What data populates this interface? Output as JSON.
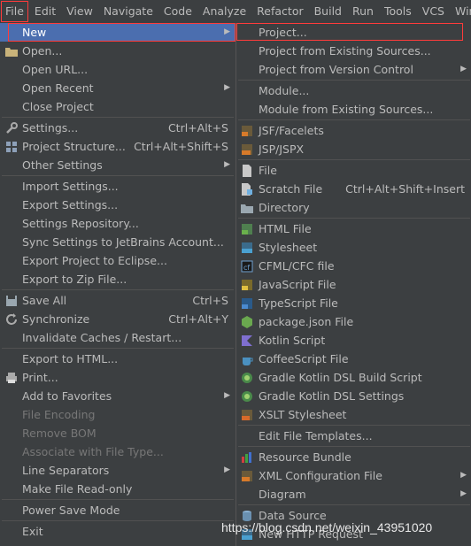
{
  "menubar": [
    "File",
    "Edit",
    "View",
    "Navigate",
    "Code",
    "Analyze",
    "Refactor",
    "Build",
    "Run",
    "Tools",
    "VCS",
    "Windo"
  ],
  "file_menu": [
    {
      "label": "New",
      "arrow": true,
      "selected": true
    },
    {
      "label": "Open...",
      "icon": "folder-icon"
    },
    {
      "label": "Open URL..."
    },
    {
      "label": "Open Recent",
      "arrow": true
    },
    {
      "label": "Close Project"
    },
    {
      "label": "Settings...",
      "icon": "wrench-icon",
      "shortcut": "Ctrl+Alt+S"
    },
    {
      "label": "Project Structure...",
      "icon": "project-structure-icon",
      "shortcut": "Ctrl+Alt+Shift+S"
    },
    {
      "label": "Other Settings",
      "arrow": true
    },
    {
      "label": "Import Settings..."
    },
    {
      "label": "Export Settings..."
    },
    {
      "label": "Settings Repository..."
    },
    {
      "label": "Sync Settings to JetBrains Account..."
    },
    {
      "label": "Export Project to Eclipse..."
    },
    {
      "label": "Export to Zip File..."
    },
    {
      "label": "Save All",
      "icon": "save-icon",
      "shortcut": "Ctrl+S"
    },
    {
      "label": "Synchronize",
      "icon": "sync-icon",
      "shortcut": "Ctrl+Alt+Y"
    },
    {
      "label": "Invalidate Caches / Restart..."
    },
    {
      "label": "Export to HTML..."
    },
    {
      "label": "Print...",
      "icon": "print-icon"
    },
    {
      "label": "Add to Favorites",
      "arrow": true
    },
    {
      "label": "File Encoding",
      "disabled": true
    },
    {
      "label": "Remove BOM",
      "disabled": true
    },
    {
      "label": "Associate with File Type...",
      "disabled": true
    },
    {
      "label": "Line Separators",
      "arrow": true
    },
    {
      "label": "Make File Read-only"
    },
    {
      "label": "Power Save Mode"
    },
    {
      "label": "Exit"
    }
  ],
  "new_menu": [
    {
      "label": "Project..."
    },
    {
      "label": "Project from Existing Sources..."
    },
    {
      "label": "Project from Version Control",
      "arrow": true
    },
    {
      "label": "Module..."
    },
    {
      "label": "Module from Existing Sources..."
    },
    {
      "label": "JSF/Facelets",
      "icon": "jsf-icon"
    },
    {
      "label": "JSP/JSPX",
      "icon": "jsp-icon"
    },
    {
      "label": "File",
      "icon": "file-icon"
    },
    {
      "label": "Scratch File",
      "icon": "scratch-icon",
      "shortcut": "Ctrl+Alt+Shift+Insert"
    },
    {
      "label": "Directory",
      "icon": "directory-icon"
    },
    {
      "label": "HTML File",
      "icon": "html-icon"
    },
    {
      "label": "Stylesheet",
      "icon": "css-icon"
    },
    {
      "label": "CFML/CFC file",
      "icon": "cfml-icon"
    },
    {
      "label": "JavaScript File",
      "icon": "js-icon"
    },
    {
      "label": "TypeScript File",
      "icon": "ts-icon"
    },
    {
      "label": "package.json File",
      "icon": "nodejs-icon"
    },
    {
      "label": "Kotlin Script",
      "icon": "kotlin-icon"
    },
    {
      "label": "CoffeeScript File",
      "icon": "coffee-icon"
    },
    {
      "label": "Gradle Kotlin DSL Build Script",
      "icon": "gradle-icon"
    },
    {
      "label": "Gradle Kotlin DSL Settings",
      "icon": "gradle-icon"
    },
    {
      "label": "XSLT Stylesheet",
      "icon": "xslt-icon"
    },
    {
      "label": "Edit File Templates..."
    },
    {
      "label": "Resource Bundle",
      "icon": "resource-bundle-icon"
    },
    {
      "label": "XML Configuration File",
      "icon": "xml-icon",
      "arrow": true
    },
    {
      "label": "Diagram",
      "arrow": true
    },
    {
      "label": "Data Source",
      "icon": "database-icon"
    },
    {
      "label": "New HTTP Request",
      "icon": "http-icon"
    }
  ],
  "watermark": "https://blog.csdn.net/weixin_43951020"
}
